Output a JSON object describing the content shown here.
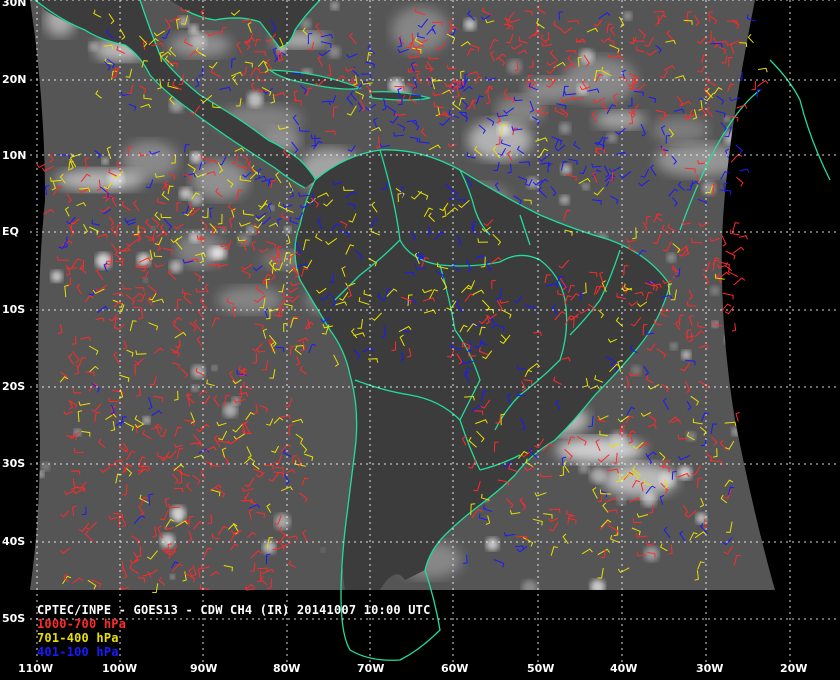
{
  "map": {
    "title": "CPTEC/INPE - GOES13 - CDW CH4 (IR) 20141007 10:00 UTC",
    "legend": [
      {
        "label": "1000-700 hPa",
        "color": "#ff2a2a"
      },
      {
        "label": "701-400 hPa",
        "color": "#e8e000"
      },
      {
        "label": "401-100 hPa",
        "color": "#1a1aff"
      }
    ],
    "lat_labels": [
      "30N",
      "20N",
      "10N",
      "EQ",
      "10S",
      "20S",
      "30S",
      "40S",
      "50S"
    ],
    "lon_labels": [
      "110W",
      "100W",
      "90W",
      "80W",
      "70W",
      "60W",
      "50W",
      "40W",
      "30W",
      "20W"
    ],
    "coastline_color": "#22dd99",
    "grid_color": "#ffffff"
  }
}
